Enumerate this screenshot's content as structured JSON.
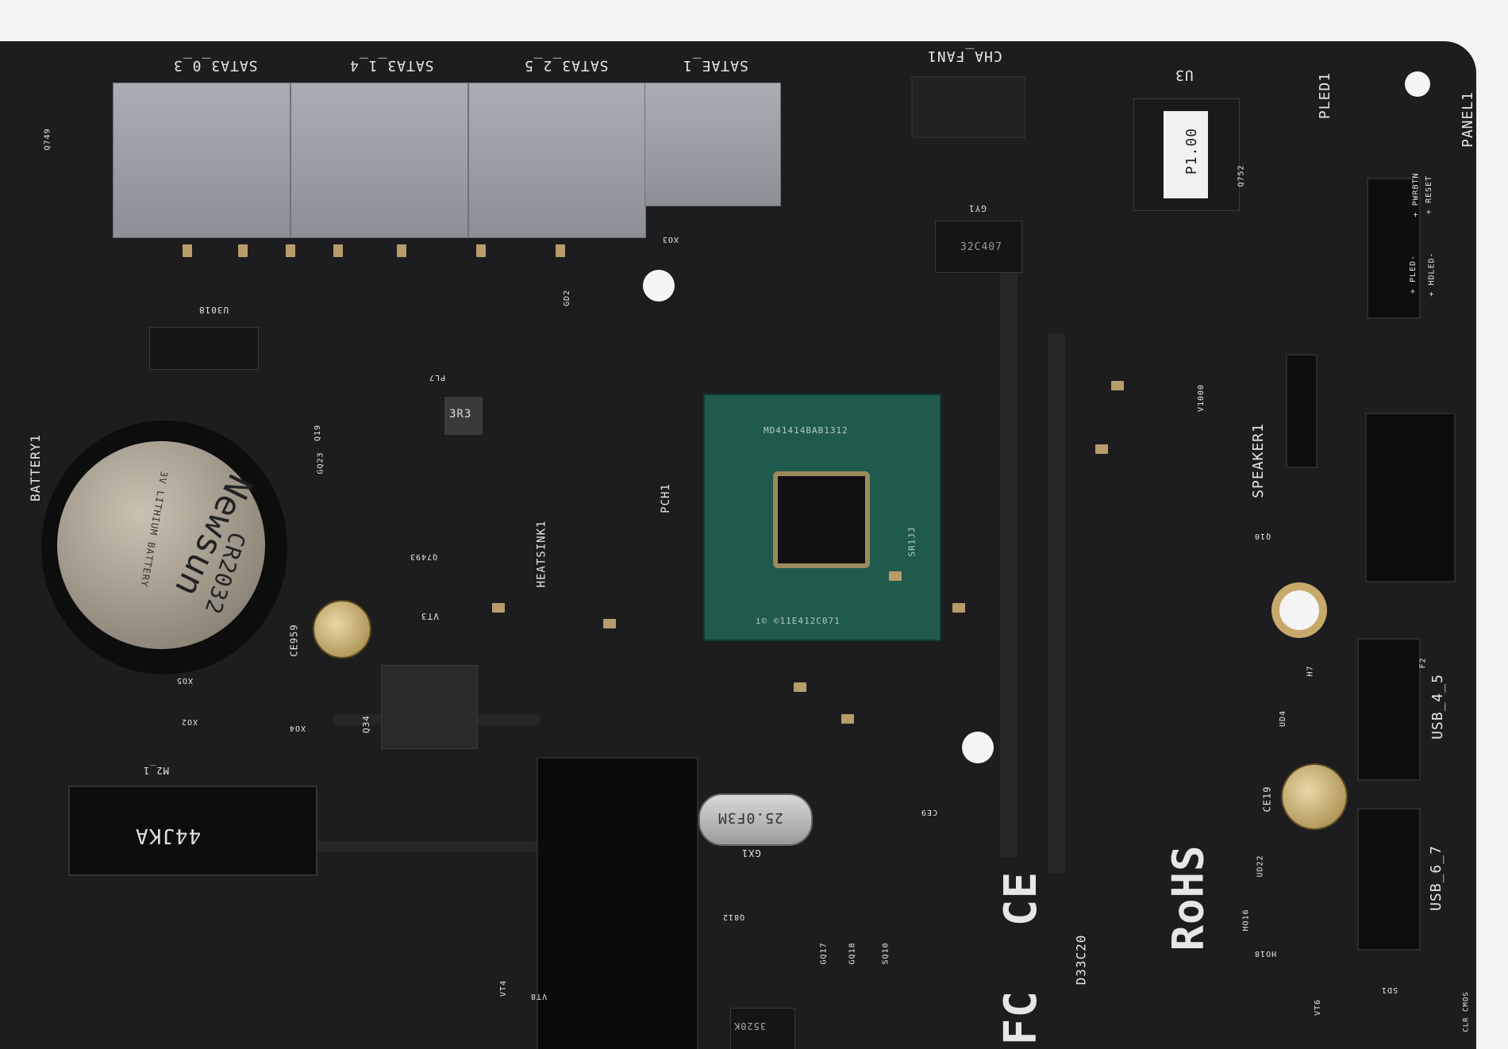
{
  "labels": {
    "sata30": "SATA3_0_3",
    "sata14": "SATA3_1_4",
    "sata25": "SATA3_2_5",
    "satae": "SATAE_1",
    "chafan": "CHA_FAN1",
    "u3": "U3",
    "p100": "P1.00",
    "pled": "PLED1",
    "panel": "PANEL1",
    "battery": "BATTERY1",
    "battery_brand": "Newsun",
    "battery_model": "CR2032",
    "battery_spec": "3V LITHIUM BATTERY",
    "pch": "PCH1",
    "heatsink": "HEATSINK1",
    "chip_top": "MD41414BAB1312",
    "chip_sr": "SR1JJ",
    "chip_bottom": "i© ©11E412C071",
    "speaker": "SPEAKER1",
    "usb45": "USB_4_5",
    "usb67": "USB_6_7",
    "m2": "M2_1",
    "m2_label": "44JKA",
    "crystal": "25.0F3M",
    "gx1": "GX1",
    "rohs": "RoHS",
    "fc": "FC",
    "ce": "CE",
    "d33": "D33C20",
    "gy1": "GY1",
    "c32": "32C407",
    "u3018": "U3018",
    "vt3": "VT3",
    "ce959": "CE959",
    "ce19": "CE19",
    "q34": "Q34",
    "xo5": "XO5",
    "xo2": "XO2",
    "xo4": "XO4",
    "xo3": "XO3",
    "gd2": "GD2",
    "q749": "Q749",
    "q7493": "Q7493",
    "q10": "Q10",
    "q752": "Q752",
    "v1000": "V1000",
    "ud4": "UD4",
    "ud22": "UD22",
    "h7": "H7",
    "ho16": "HO16",
    "ho18": "HO18",
    "f2": "F2",
    "q812": "Q812",
    "gq17": "GQ17",
    "gq18": "GQ18",
    "sq10": "SQ10",
    "vt4": "VT4",
    "vt8": "VT8",
    "vt6": "VT6",
    "sd1": "SD1",
    "ce9": "CE9",
    "r3k3": "3R3",
    "ic3520": "3520K",
    "q23": "GQ23",
    "q19": "Q19",
    "pl7": "PL7",
    "hdled": "+ HDLED-",
    "pled_s": "+ PLED-",
    "reset": "+ RESET",
    "pwrbtn": "+ PWRBTN",
    "cmos": "CLR CMOS"
  }
}
